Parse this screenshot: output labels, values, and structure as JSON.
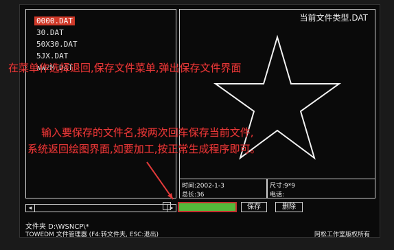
{
  "files": [
    "0000.DAT",
    "30.DAT",
    "50X30.DAT",
    "5JX.DAT",
    "WW2M.DAT"
  ],
  "preview": {
    "title": "当前文件类型.DAT"
  },
  "info": {
    "time_label": "时间:2002-1-3",
    "length_label": "总长:36",
    "size_label": "尺寸:9*9",
    "phone_label": "电话:"
  },
  "buttons": {
    "save": "保存",
    "delete": "删除"
  },
  "footer": {
    "folder": "文件夹 D:\\WSNCP\\*",
    "status": "TOWEDM 文件管理器 (F4:转文件夹, ESC:退出)",
    "copyright": "阿松工作室版权所有"
  },
  "annotations": {
    "line1": "在菜单作选择退回,保存文件菜单,弹出保存文件界面",
    "line2": "输入要保存的文件名,按两次回车保存当前文件,",
    "line3": "系统返回绘图界面,如要加工,按正常生成程序即可。"
  },
  "colors": {
    "accent": "#e23a3a",
    "selected": "#d03a2a",
    "input": "#55b83a"
  }
}
